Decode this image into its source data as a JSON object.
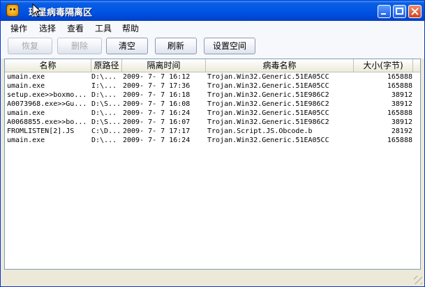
{
  "window": {
    "title": "瑞星病毒隔离区"
  },
  "menu": [
    "操作",
    "选择",
    "查看",
    "工具",
    "帮助"
  ],
  "toolbar": {
    "restore": "恢复",
    "delete": "删除",
    "clear": "清空",
    "refresh": "刷新",
    "settings": "设置空间"
  },
  "table": {
    "headers": [
      "名称",
      "原路径",
      "隔离时间",
      "病毒名称",
      "大小(字节)"
    ],
    "rows": [
      [
        "umain.exe",
        "D:\\...",
        "2009- 7- 7 16:12",
        "Trojan.Win32.Generic.51EA05CC",
        "165888"
      ],
      [
        "umain.exe",
        "I:\\...",
        "2009- 7- 7 17:36",
        "Trojan.Win32.Generic.51EA05CC",
        "165888"
      ],
      [
        "setup.exe>>boxmo...",
        "D:\\...",
        "2009- 7- 7 16:18",
        "Trojan.Win32.Generic.51E986C2",
        "38912"
      ],
      [
        "A0073968.exe>>Gu...",
        "D:\\S...",
        "2009- 7- 7 16:08",
        "Trojan.Win32.Generic.51E986C2",
        "38912"
      ],
      [
        "umain.exe",
        "D:\\...",
        "2009- 7- 7 16:24",
        "Trojan.Win32.Generic.51EA05CC",
        "165888"
      ],
      [
        "A0068855.exe>>bo...",
        "D:\\S...",
        "2009- 7- 7 16:07",
        "Trojan.Win32.Generic.51E986C2",
        "38912"
      ],
      [
        "FROMLISTEN[2].JS",
        "C:\\D...",
        "2009- 7- 7 17:17",
        "Trojan.Script.JS.Obcode.b",
        "28192"
      ],
      [
        "umain.exe",
        "D:\\...",
        "2009- 7- 7 16:24",
        "Trojan.Win32.Generic.51EA05CC",
        "165888"
      ]
    ]
  },
  "colors": {
    "titlebar": "#0055e5",
    "window_bg": "#ece9d8",
    "menubar_bg": "#f7f8fb",
    "list_border": "#7f9db9"
  }
}
